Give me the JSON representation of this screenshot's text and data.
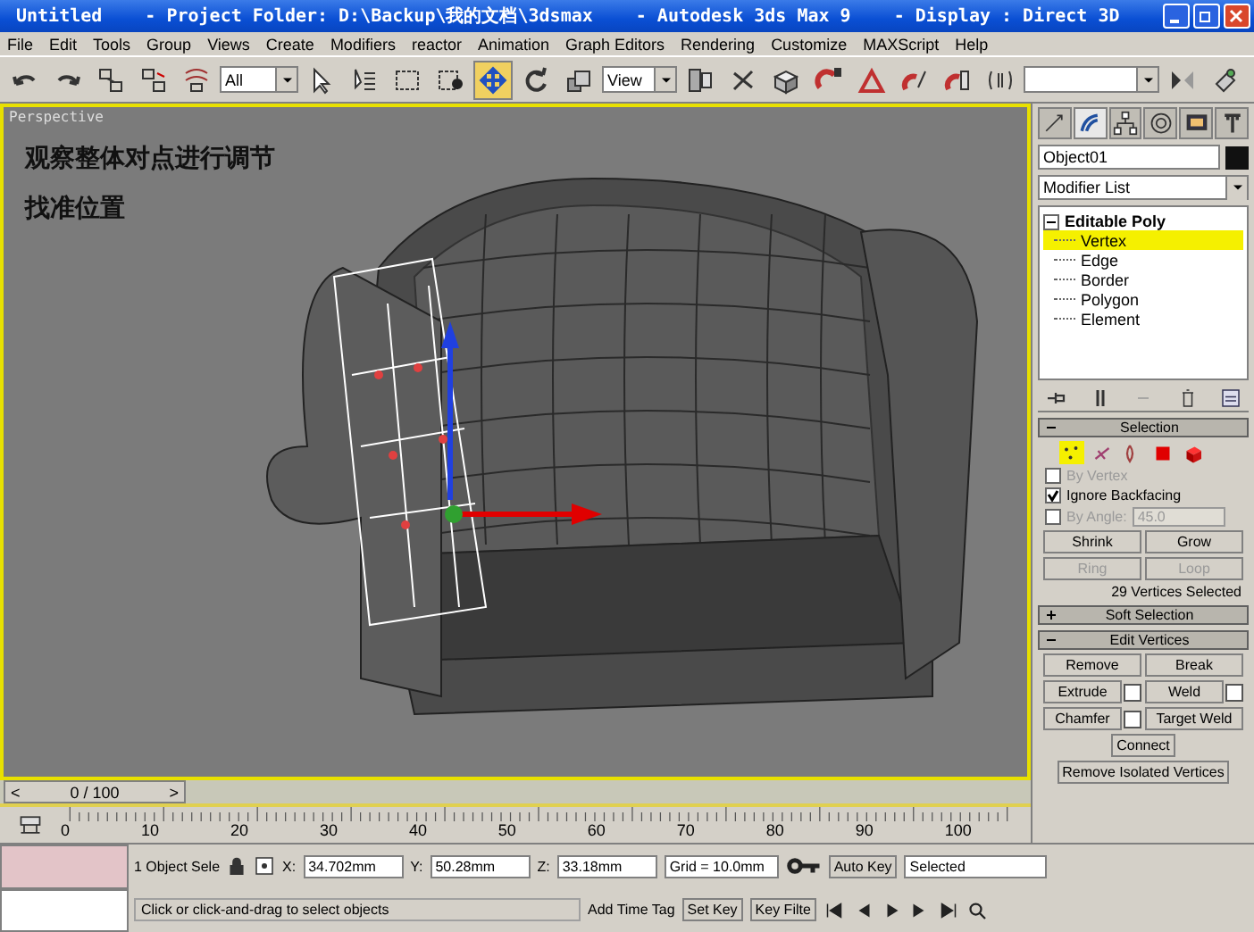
{
  "window": {
    "title_parts": [
      "Untitled",
      "- Project Folder: D:\\Backup\\我的文档\\3dsmax",
      "- Autodesk 3ds Max 9",
      "- Display : Direct 3D"
    ]
  },
  "menu": [
    "File",
    "Edit",
    "Tools",
    "Group",
    "Views",
    "Create",
    "Modifiers",
    "reactor",
    "Animation",
    "Graph Editors",
    "Rendering",
    "Customize",
    "MAXScript",
    "Help"
  ],
  "toolbar": [
    {
      "kind": "tool",
      "selected": false
    },
    {
      "kind": "tool",
      "selected": false
    },
    {
      "kind": "tool",
      "selected": false
    },
    {
      "kind": "tool",
      "selected": false
    },
    {
      "kind": "tool",
      "selected": false
    },
    {
      "kind": "dropdown",
      "value": "All"
    },
    {
      "kind": "tool",
      "selected": false
    },
    {
      "kind": "tool",
      "selected": false
    },
    {
      "kind": "tool",
      "selected": false
    },
    {
      "kind": "tool",
      "selected": false
    },
    {
      "kind": "tool",
      "selected": true
    },
    {
      "kind": "tool",
      "selected": false
    },
    {
      "kind": "tool",
      "selected": false
    },
    {
      "kind": "dropdown",
      "value": "View"
    },
    {
      "kind": "tool",
      "selected": false
    },
    {
      "kind": "tool",
      "selected": false
    },
    {
      "kind": "tool",
      "selected": false
    },
    {
      "kind": "tool",
      "selected": false
    },
    {
      "kind": "tool",
      "selected": false
    },
    {
      "kind": "tool",
      "selected": false
    },
    {
      "kind": "tool",
      "selected": false
    },
    {
      "kind": "tool",
      "selected": false
    },
    {
      "kind": "dropdown"
    },
    {
      "kind": "tool",
      "selected": false
    },
    {
      "kind": "tool",
      "selected": false
    }
  ],
  "viewport": {
    "label": "Perspective",
    "notes": [
      "观察整体对点进行调节",
      "找准位置"
    ]
  },
  "command_panel": {
    "tabs": [
      {
        "selected": false
      },
      {
        "selected": true
      },
      {
        "selected": false
      },
      {
        "selected": false
      },
      {
        "selected": false
      },
      {
        "selected": false
      }
    ],
    "object_name": "Object01",
    "modifier_list": "Modifier List",
    "stack": {
      "label": "Editable Poly",
      "expanded": true,
      "children": [
        {
          "label": "Vertex",
          "selected": true
        },
        {
          "label": "Edge",
          "selected": false
        },
        {
          "label": "Border",
          "selected": false
        },
        {
          "label": "Polygon",
          "selected": false
        },
        {
          "label": "Element",
          "selected": false
        }
      ]
    },
    "rollouts": [
      {
        "kind": "selection",
        "title": "Selection",
        "expanded": true,
        "levels": [
          {
            "selected": true
          },
          {
            "selected": false
          },
          {
            "selected": false
          },
          {
            "selected": false
          },
          {
            "selected": false
          }
        ],
        "options": [
          {
            "label": "By Vertex",
            "checked": false,
            "disabled": true
          },
          {
            "label": "Ignore Backfacing",
            "checked": true,
            "disabled": false
          },
          {
            "label": "By Angle:",
            "checked": false,
            "disabled": true,
            "value": "45.0"
          }
        ],
        "buttons": [
          {
            "label": "Shrink",
            "disabled": false
          },
          {
            "label": "Grow",
            "disabled": false
          },
          {
            "label": "Ring",
            "disabled": true
          },
          {
            "label": "Loop",
            "disabled": true
          }
        ],
        "status": "29 Vertices Selected"
      },
      {
        "title": "Soft Selection",
        "expanded": false
      },
      {
        "kind": "buttons",
        "title": "Edit Vertices",
        "expanded": true,
        "rows": [
          [
            {
              "label": "Remove",
              "settings": false
            },
            {
              "label": "Break",
              "settings": false
            }
          ],
          [
            {
              "label": "Extrude",
              "settings": true
            },
            {
              "label": "Weld",
              "settings": true
            }
          ],
          [
            {
              "label": "Chamfer",
              "settings": true
            },
            {
              "label": "Target Weld",
              "settings": false
            }
          ],
          [
            {
              "label": "Connect"
            }
          ],
          [
            {
              "label": "Remove Isolated Vertices"
            }
          ]
        ]
      }
    ]
  },
  "timeline": {
    "prev": "<",
    "frame": "0 / 100",
    "next": ">",
    "level": 0,
    "ticks": [
      "0",
      "10",
      "20",
      "30",
      "40",
      "50",
      "60",
      "70",
      "80",
      "90",
      "100"
    ]
  },
  "status": {
    "selection": "1 Object Sele",
    "coords": [
      {
        "axis": "X:",
        "value": "34.702mm"
      },
      {
        "axis": "Y:",
        "value": "50.28mm"
      },
      {
        "axis": "Z:",
        "value": "33.18mm"
      }
    ],
    "grid": "Grid = 10.0mm",
    "prompt": "Click or click-and-drag to select objects",
    "time_tag": "Add Time Tag",
    "auto_key": "Auto Key",
    "key_mode": "Selected",
    "set_key": "Set Key",
    "key_filters": "Key Filte"
  }
}
